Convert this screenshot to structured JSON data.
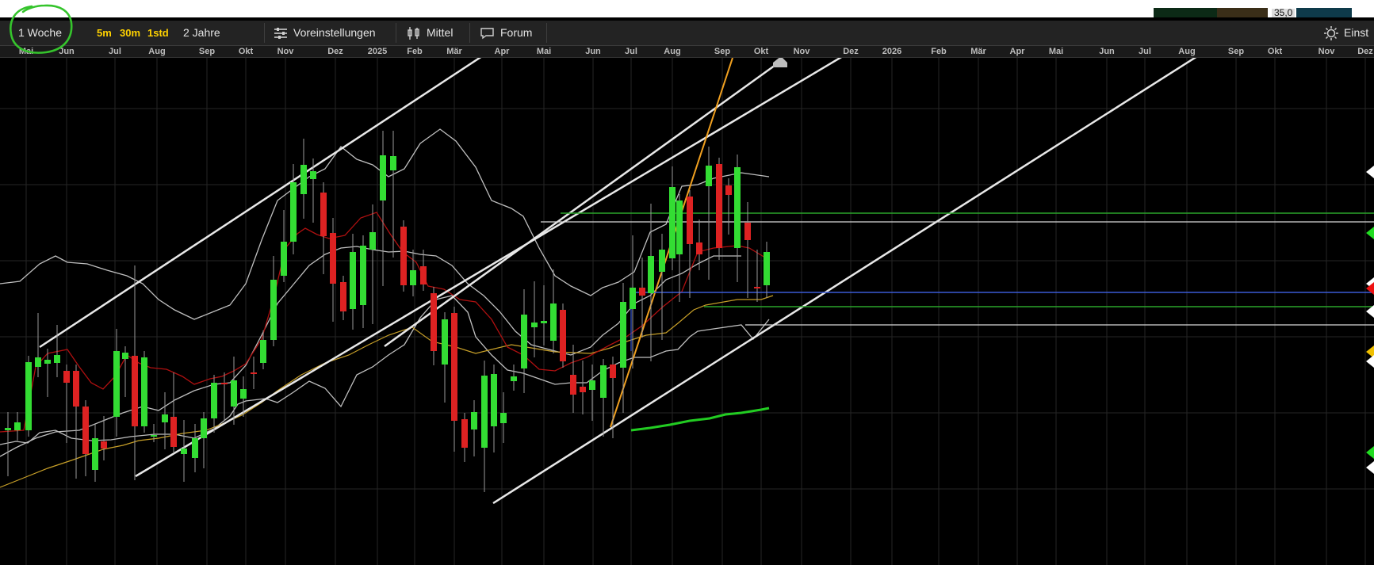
{
  "toolbar": {
    "timeframe_label": "1 Woche",
    "interval_5m": "5m",
    "interval_30m": "30m",
    "interval_1std": "1std",
    "range_label": "2 Jahre",
    "presets_label": "Voreinstellungen",
    "indicator_label": "Mittel",
    "forum_label": "Forum",
    "settings_label": "Einst",
    "icons": {
      "presets": "sliders-icon",
      "indicator": "candlestick-icon",
      "forum": "speech-bubble-icon",
      "settings": "gear-icon"
    }
  },
  "top_strip": {
    "value_text": "35,0"
  },
  "time_axis": {
    "labels": [
      "Mai",
      "Jun",
      "Jul",
      "Aug",
      "Sep",
      "Okt",
      "Nov",
      "Dez",
      "2025",
      "Feb",
      "Mär",
      "Apr",
      "Mai",
      "Jun",
      "Jul",
      "Aug",
      "Sep",
      "Okt",
      "Nov",
      "Dez",
      "2026",
      "Feb",
      "Mär",
      "Apr",
      "Mai",
      "Jun",
      "Jul",
      "Aug",
      "Sep",
      "Okt",
      "Nov",
      "Dez"
    ]
  },
  "colors": {
    "background": "#000000",
    "grid": "#262626",
    "candle_up": "#33dd33",
    "candle_down": "#dd2222",
    "trend_lines": "#ffffff",
    "steep_trend": "#f0a020",
    "bollinger": "#bfbfbf",
    "ma_short": "#b01010",
    "ma_long": "#c8a028",
    "volume_ma": "#22cc22",
    "level_green": "#2aa52a",
    "level_white": "#d8d8d8",
    "level_blue": "#3b5bd6",
    "circle_highlight": "#35c42c"
  },
  "markers": [
    "white",
    "green",
    "white",
    "red",
    "white",
    "yellow",
    "white",
    "green",
    "white"
  ]
}
